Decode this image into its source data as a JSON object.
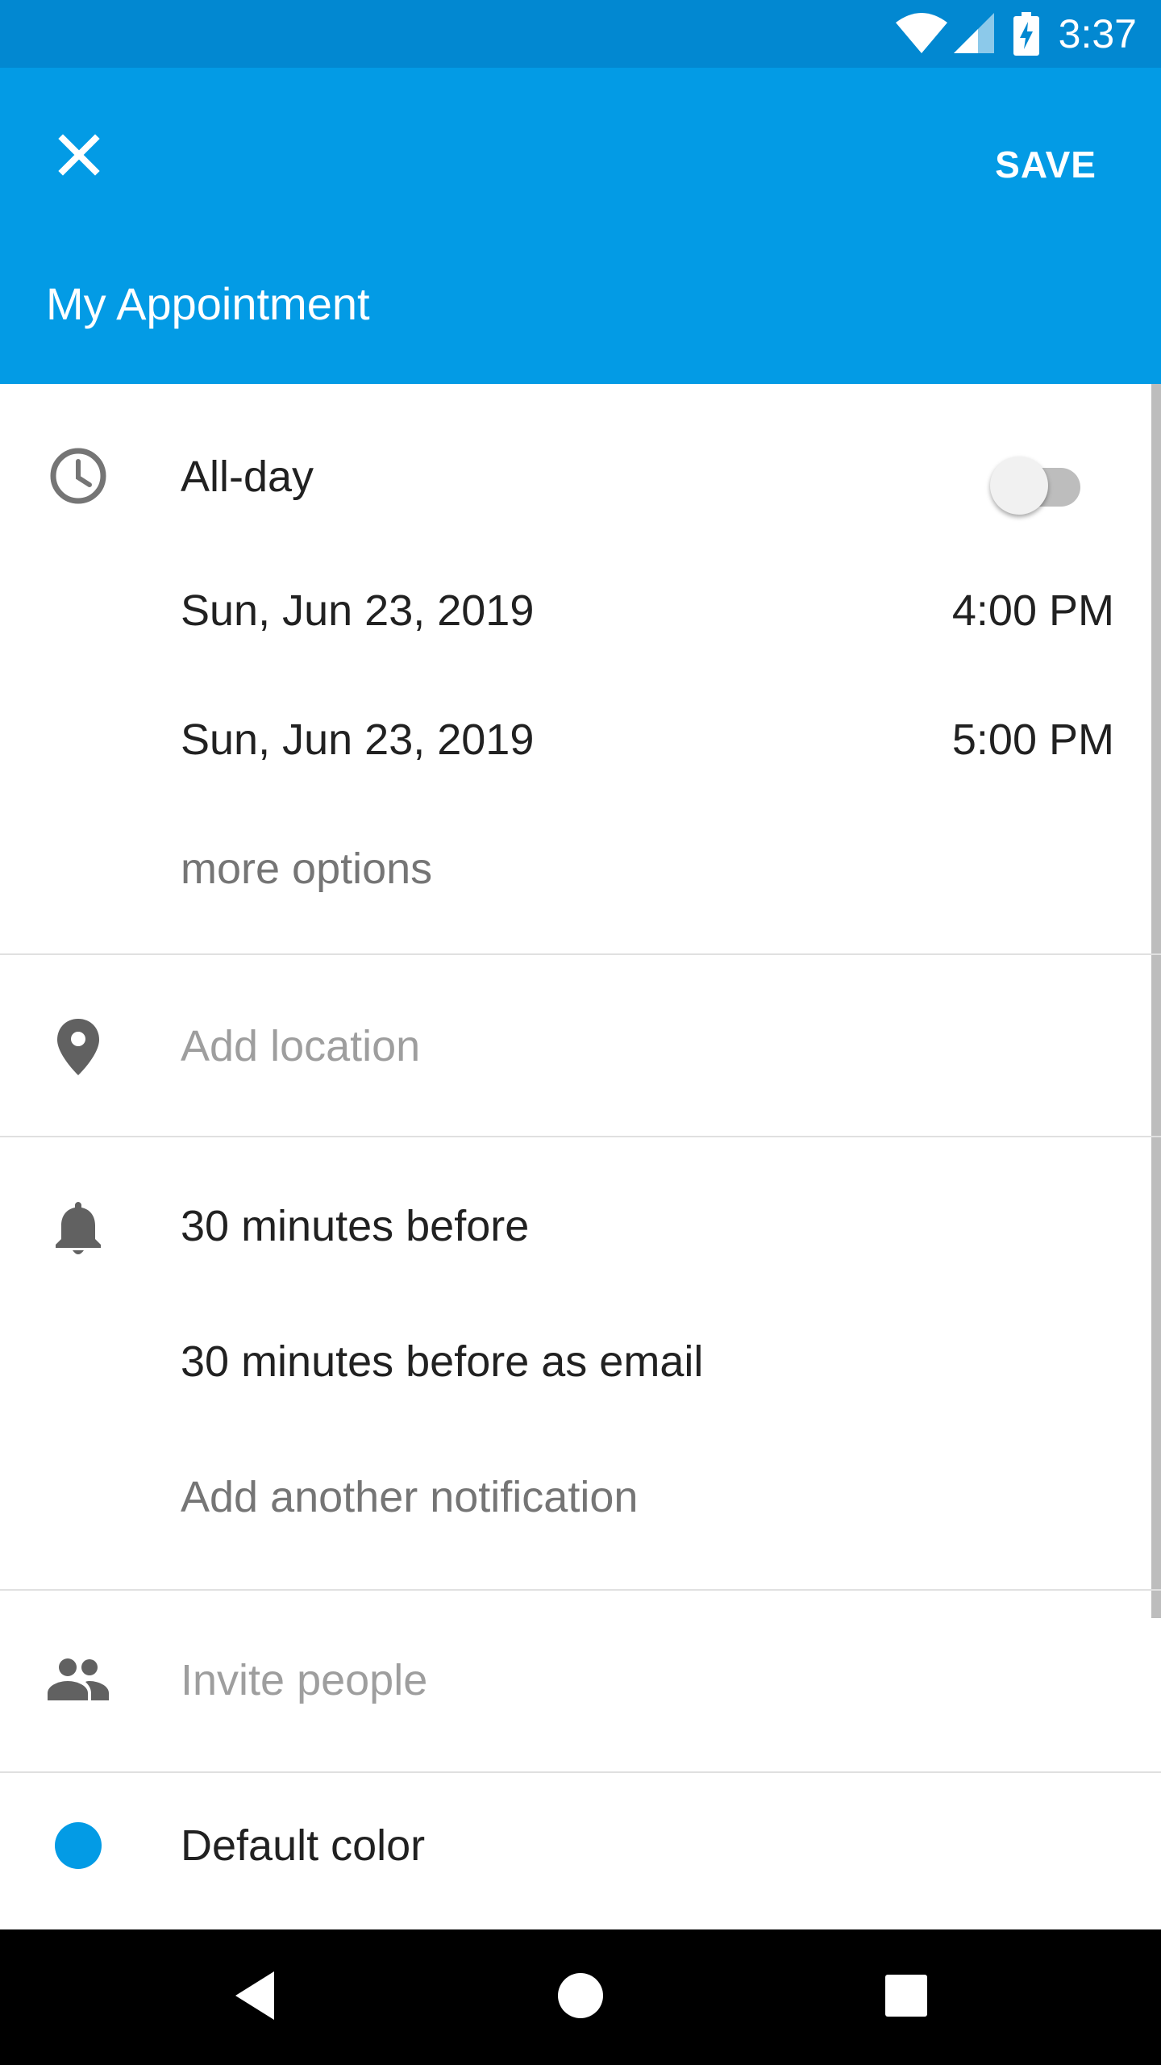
{
  "status_bar": {
    "time": "3:37",
    "icons": [
      "wifi-icon",
      "signal-icon",
      "battery-charging-icon"
    ]
  },
  "app_bar": {
    "close_icon": "close-icon",
    "save_label": "SAVE",
    "title": "My Appointment"
  },
  "time_section": {
    "all_day_label": "All-day",
    "all_day_on": false,
    "start_date": "Sun, Jun 23, 2019",
    "start_time": "4:00 PM",
    "end_date": "Sun, Jun 23, 2019",
    "end_time": "5:00 PM",
    "more_options": "more options"
  },
  "location": {
    "placeholder": "Add location"
  },
  "notifications": {
    "items": [
      "30 minutes before",
      "30 minutes before as email"
    ],
    "add_label": "Add another notification"
  },
  "people": {
    "placeholder": "Invite people"
  },
  "color": {
    "label": "Default color",
    "value": "#039BE5"
  },
  "nav": {
    "icons": [
      "back-icon",
      "home-icon",
      "recents-icon"
    ]
  }
}
